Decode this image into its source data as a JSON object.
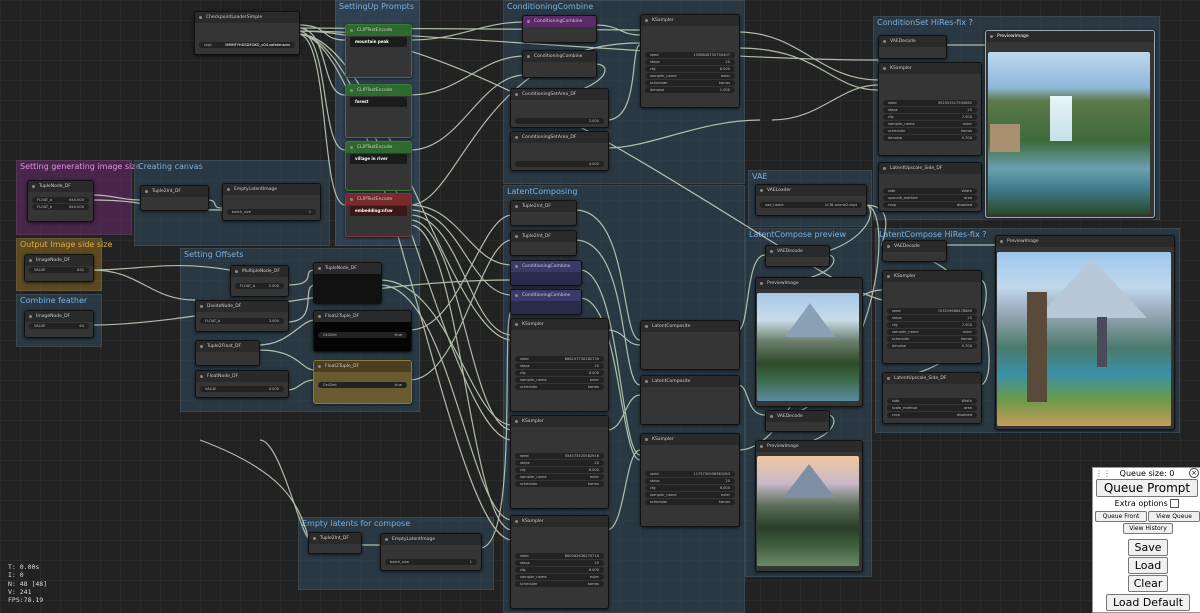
{
  "groups": [
    {
      "id": "g1",
      "title": "SettingUp Prompts",
      "color": "#3a5a78",
      "tcolor": "#7bb0e0"
    },
    {
      "id": "g2",
      "title": "ConditioningCombine",
      "color": "#2f4a5e",
      "tcolor": "#7bb0e0"
    },
    {
      "id": "g3",
      "title": "ConditionSet HiRes-fix ?",
      "color": "#2f4a5e",
      "tcolor": "#7bb0e0"
    },
    {
      "id": "g4",
      "title": "Setting generating image size",
      "color": "#6a2a6a",
      "tcolor": "#e090e0"
    },
    {
      "id": "g5",
      "title": "Creating canvas",
      "color": "#2f4a5e",
      "tcolor": "#7bb0e0"
    },
    {
      "id": "g6",
      "title": "Output Image side size",
      "color": "#8a6a20",
      "tcolor": "#e0b040"
    },
    {
      "id": "g7",
      "title": "Setting Offsets",
      "color": "#2f4a5e",
      "tcolor": "#7bb0e0"
    },
    {
      "id": "g8",
      "title": "Combine feather",
      "color": "#2f4a5e",
      "tcolor": "#7bb0e0"
    },
    {
      "id": "g9",
      "title": "LatentComposing",
      "color": "#2f4a5e",
      "tcolor": "#7bb0e0"
    },
    {
      "id": "g10",
      "title": "VAE",
      "color": "#2f4a5e",
      "tcolor": "#7bb0e0"
    },
    {
      "id": "g11",
      "title": "LatentCompose preview",
      "color": "#2f4a5e",
      "tcolor": "#7bb0e0"
    },
    {
      "id": "g12",
      "title": "LatentCompose HiRes-fix ?",
      "color": "#2f4a5e",
      "tcolor": "#7bb0e0"
    },
    {
      "id": "g13",
      "title": "Empty latents for compose",
      "color": "#2f4a5e",
      "tcolor": "#7bb0e0"
    }
  ],
  "nodes": {
    "ckpt": {
      "title": "CheckpointLoaderSimple",
      "w1l": "ckpt",
      "w1v": "MMMFYHDSDEGKO_v04.safetensors"
    },
    "clip1": {
      "title": "CLIPTextEncode",
      "text": "mountain peak"
    },
    "clip2": {
      "title": "CLIPTextEncode",
      "text": "forest"
    },
    "clip3": {
      "title": "CLIPTextEncode",
      "text": "village in river"
    },
    "clip4": {
      "title": "CLIPTextEncode",
      "text": "embedding:nfsw"
    },
    "cc1": {
      "title": "ConditioningCombine"
    },
    "cc2": {
      "title": "ConditioningCombine"
    },
    "csa1": {
      "title": "ConditioningSetArea_DF",
      "val": "2.000"
    },
    "csa2": {
      "title": "ConditioningSetArea_DF",
      "val": "4.000"
    },
    "ks_top": {
      "title": "KSampler",
      "seed": "1508846750750407",
      "steps": "20",
      "cfg": "6.000",
      "sampler": "euler",
      "sched": "karras",
      "denoise": "1.000"
    },
    "tuple_gen": {
      "title": "TupleNode_DF",
      "a": "640.000",
      "b": "640.000"
    },
    "tuple2int": {
      "title": "Tuple2Int_DF"
    },
    "empty_lat": {
      "title": "EmptyLatentImage",
      "batch": "1"
    },
    "imgnode1": {
      "title": "ImageNode_DF",
      "val": "832"
    },
    "imgnode2": {
      "title": "ImageNode_DF",
      "val": "64"
    },
    "mult": {
      "title": "MultipleNode_DF",
      "val": "2.000"
    },
    "divide": {
      "title": "DivideNode_DF",
      "val": "3.000"
    },
    "tuple2float": {
      "title": "Tuple2Float_DF"
    },
    "float_node": {
      "title": "FloatNode_DF",
      "val": "0.000"
    },
    "tuple_off": {
      "title": "TupleNode_DF"
    },
    "float2tuple1": {
      "title": "Float2Tuple_DF",
      "val": "true"
    },
    "float2tuple2": {
      "title": "Float2Tuple_DF",
      "val": "true"
    },
    "lc_t2i1": {
      "title": "Tuple2Int_DF"
    },
    "lc_t2i2": {
      "title": "Tuple2Int_DF"
    },
    "lc_cc1": {
      "title": "ConditioningCombine"
    },
    "lc_cc2": {
      "title": "ConditioningCombine"
    },
    "lc_ks1": {
      "title": "KSampler",
      "seed": "886237750282739"
    },
    "lc_ks2": {
      "title": "KSampler",
      "seed": "554573520562916"
    },
    "lc_ks3": {
      "title": "KSampler",
      "seed": "860062636270716"
    },
    "lcomp1": {
      "title": "LatentComposite"
    },
    "lcomp2": {
      "title": "LatentComposite"
    },
    "ks_mid": {
      "title": "KSampler",
      "seed": "1175750958361063"
    },
    "vae_loader": {
      "title": "VAELoader",
      "val": "kl-f8-anime2.ckpt"
    },
    "vaedec_top": {
      "title": "VAEDecode"
    },
    "preview_top": {
      "title": "PreviewImage"
    },
    "ks_hires": {
      "title": "KSampler",
      "seed": "392351517934062"
    },
    "lus1": {
      "title": "LatentUpscale_Side_DF"
    },
    "vd_prev1": {
      "title": "VAEDecode"
    },
    "pi_prev1": {
      "title": "PreviewImage"
    },
    "vd_prev2": {
      "title": "VAEDecode"
    },
    "pi_prev2": {
      "title": "PreviewImage"
    },
    "vd_hires2": {
      "title": "VAEDecode"
    },
    "pi_hires2": {
      "title": "PreviewImage"
    },
    "ks_hires2": {
      "title": "KSampler",
      "seed": "703529668478680"
    },
    "lus2": {
      "title": "LatentUpscale_Side_DF"
    },
    "t2i_empty": {
      "title": "Tuple2Int_DF"
    },
    "empty_lat2": {
      "title": "EmptyLatentImage",
      "batch": "1"
    }
  },
  "queue": {
    "size_label": "Queue size: 0",
    "queue_prompt": "Queue Prompt",
    "extra_options": "Extra options",
    "queue_front": "Queue Front",
    "view_queue": "View Queue",
    "view_history": "View History",
    "save": "Save",
    "load": "Load",
    "clear": "Clear",
    "load_default": "Load Default"
  },
  "stats": {
    "t": "T: 0.00s",
    "i": "I: 0",
    "n": "N: 48 [48]",
    "v": "V: 241",
    "fps": "FPS:78.19"
  },
  "colors": {
    "link": "#c8d8c0",
    "accent_green": "#2e6a2e",
    "accent_red": "#7a2a2a",
    "accent_purple": "#5a2a6a"
  }
}
